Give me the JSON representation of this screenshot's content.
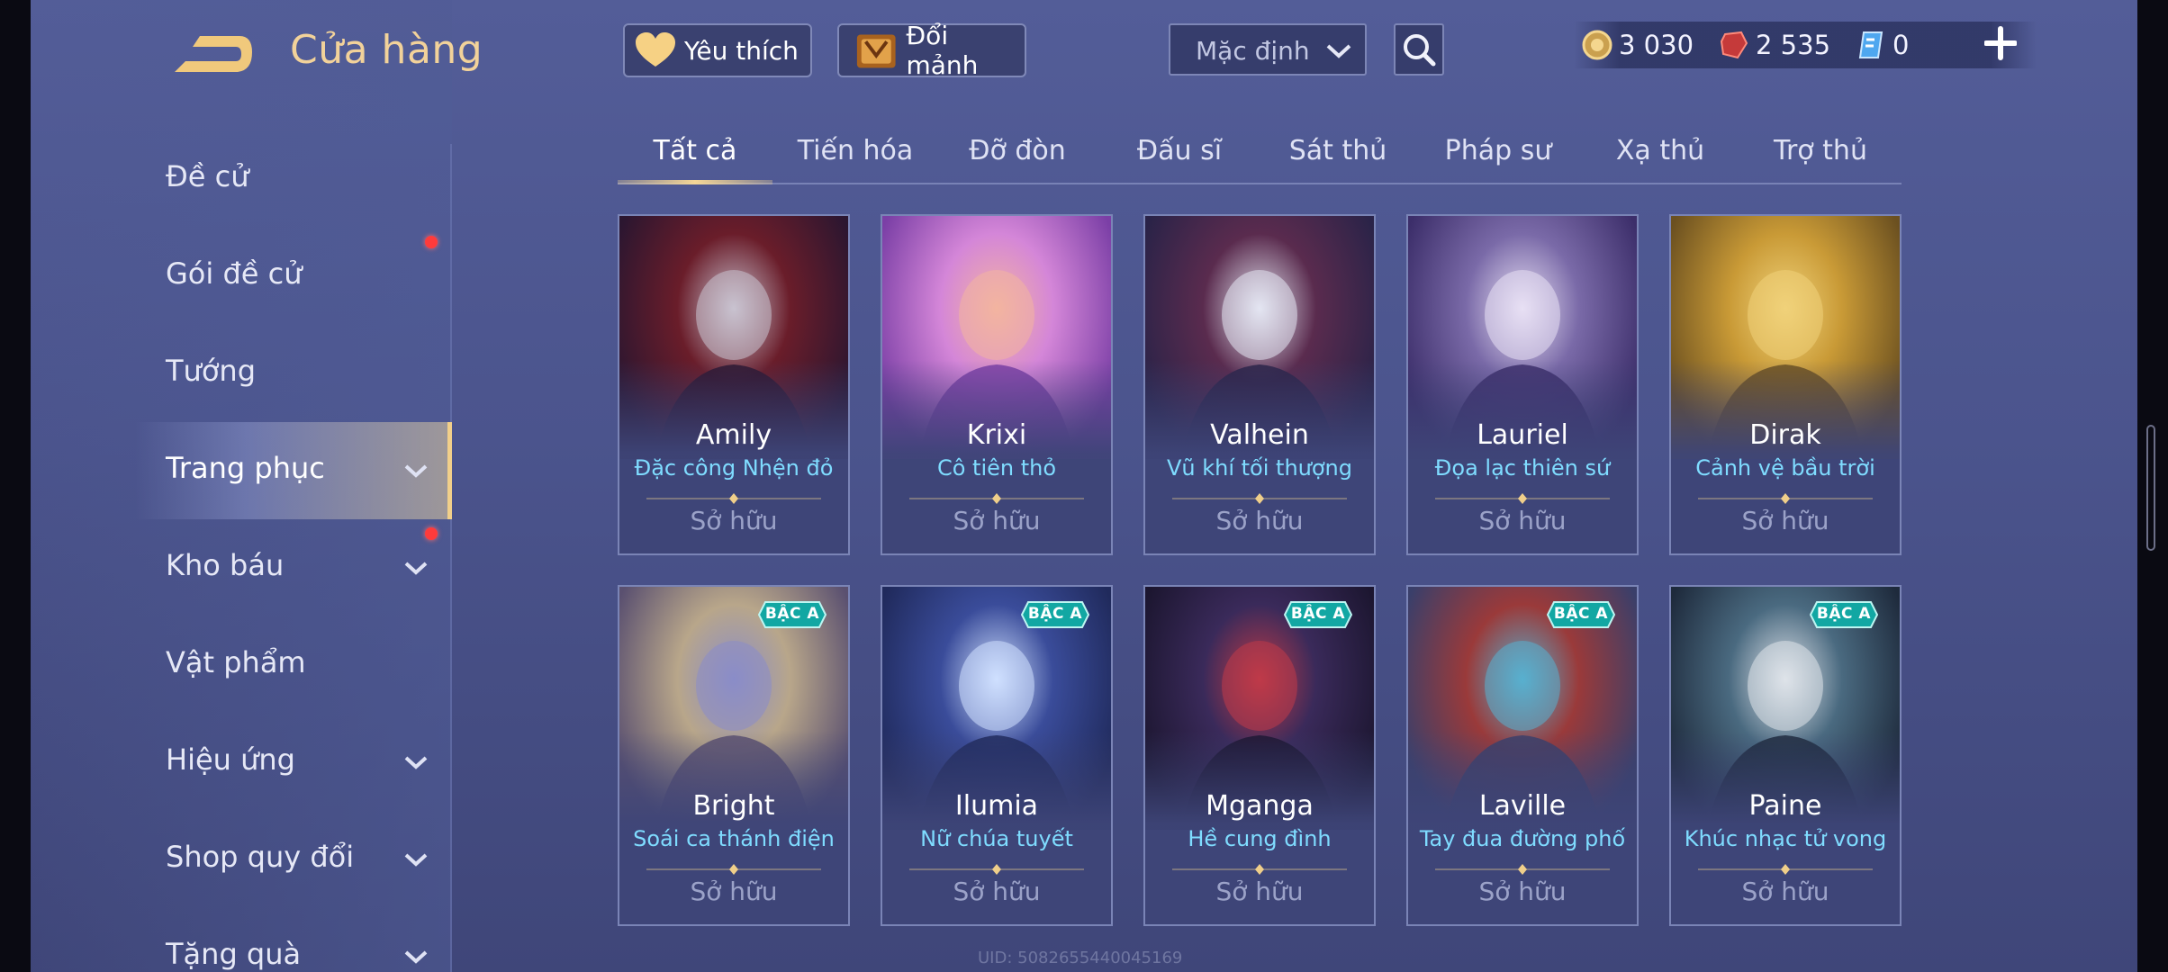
{
  "header": {
    "title": "Cửa hàng"
  },
  "top_buttons": {
    "favorite_label": "Yêu thích",
    "exchange_label": "Đổi mảnh"
  },
  "sort": {
    "selected": "Mặc định"
  },
  "currencies": [
    {
      "icon": "gold-coin-icon",
      "value": "3 030"
    },
    {
      "icon": "red-ruby-icon",
      "value": "2 535"
    },
    {
      "icon": "voucher-icon",
      "value": "0"
    }
  ],
  "sidebar": {
    "items": [
      {
        "label": "Đề cử",
        "has_chevron": false,
        "dot": false,
        "active": false
      },
      {
        "label": "Gói đề cử",
        "has_chevron": false,
        "dot": true,
        "active": false
      },
      {
        "label": "Tướng",
        "has_chevron": false,
        "dot": false,
        "active": false
      },
      {
        "label": "Trang phục",
        "has_chevron": true,
        "dot": false,
        "active": true
      },
      {
        "label": "Kho báu",
        "has_chevron": true,
        "dot": true,
        "active": false
      },
      {
        "label": "Vật phẩm",
        "has_chevron": false,
        "dot": false,
        "active": false
      },
      {
        "label": "Hiệu ứng",
        "has_chevron": true,
        "dot": false,
        "active": false
      },
      {
        "label": "Shop quy đổi",
        "has_chevron": true,
        "dot": false,
        "active": false
      },
      {
        "label": "Tặng quà",
        "has_chevron": true,
        "dot": false,
        "active": false
      }
    ]
  },
  "tabs": [
    "Tất cả",
    "Tiến hóa",
    "Đỡ đòn",
    "Đấu sĩ",
    "Sát thủ",
    "Pháp sư",
    "Xạ thủ",
    "Trợ thủ"
  ],
  "active_tab": 0,
  "cards": [
    {
      "hero": "Amily",
      "skin": "Đặc công Nhện đỏ",
      "status": "Sở hữu",
      "badge": ""
    },
    {
      "hero": "Krixi",
      "skin": "Cô tiên thỏ",
      "status": "Sở hữu",
      "badge": ""
    },
    {
      "hero": "Valhein",
      "skin": "Vũ khí tối thượng",
      "status": "Sở hữu",
      "badge": ""
    },
    {
      "hero": "Lauriel",
      "skin": "Đọa lạc thiên sứ",
      "status": "Sở hữu",
      "badge": ""
    },
    {
      "hero": "Dirak",
      "skin": "Cảnh vệ bầu trời",
      "status": "Sở hữu",
      "badge": ""
    },
    {
      "hero": "Bright",
      "skin": "Soái ca thánh điện",
      "status": "Sở hữu",
      "badge": "BẬC A"
    },
    {
      "hero": "Ilumia",
      "skin": "Nữ chúa tuyết",
      "status": "Sở hữu",
      "badge": "BẬC A"
    },
    {
      "hero": "Mganga",
      "skin": "Hề cung đình",
      "status": "Sở hữu",
      "badge": "BẬC A"
    },
    {
      "hero": "Laville",
      "skin": "Tay đua đường phố",
      "status": "Sở hữu",
      "badge": "BẬC A"
    },
    {
      "hero": "Paine",
      "skin": "Khúc nhạc tử vong",
      "status": "Sở hữu",
      "badge": "BẬC A"
    }
  ],
  "footer": {
    "uid": "UID: 5082655440045169"
  },
  "colors": {
    "accent_gold": "#f2d29a",
    "skin_name": "#7fdcff",
    "badge_teal": "#12a7a3",
    "notification": "#ff3b3b"
  }
}
